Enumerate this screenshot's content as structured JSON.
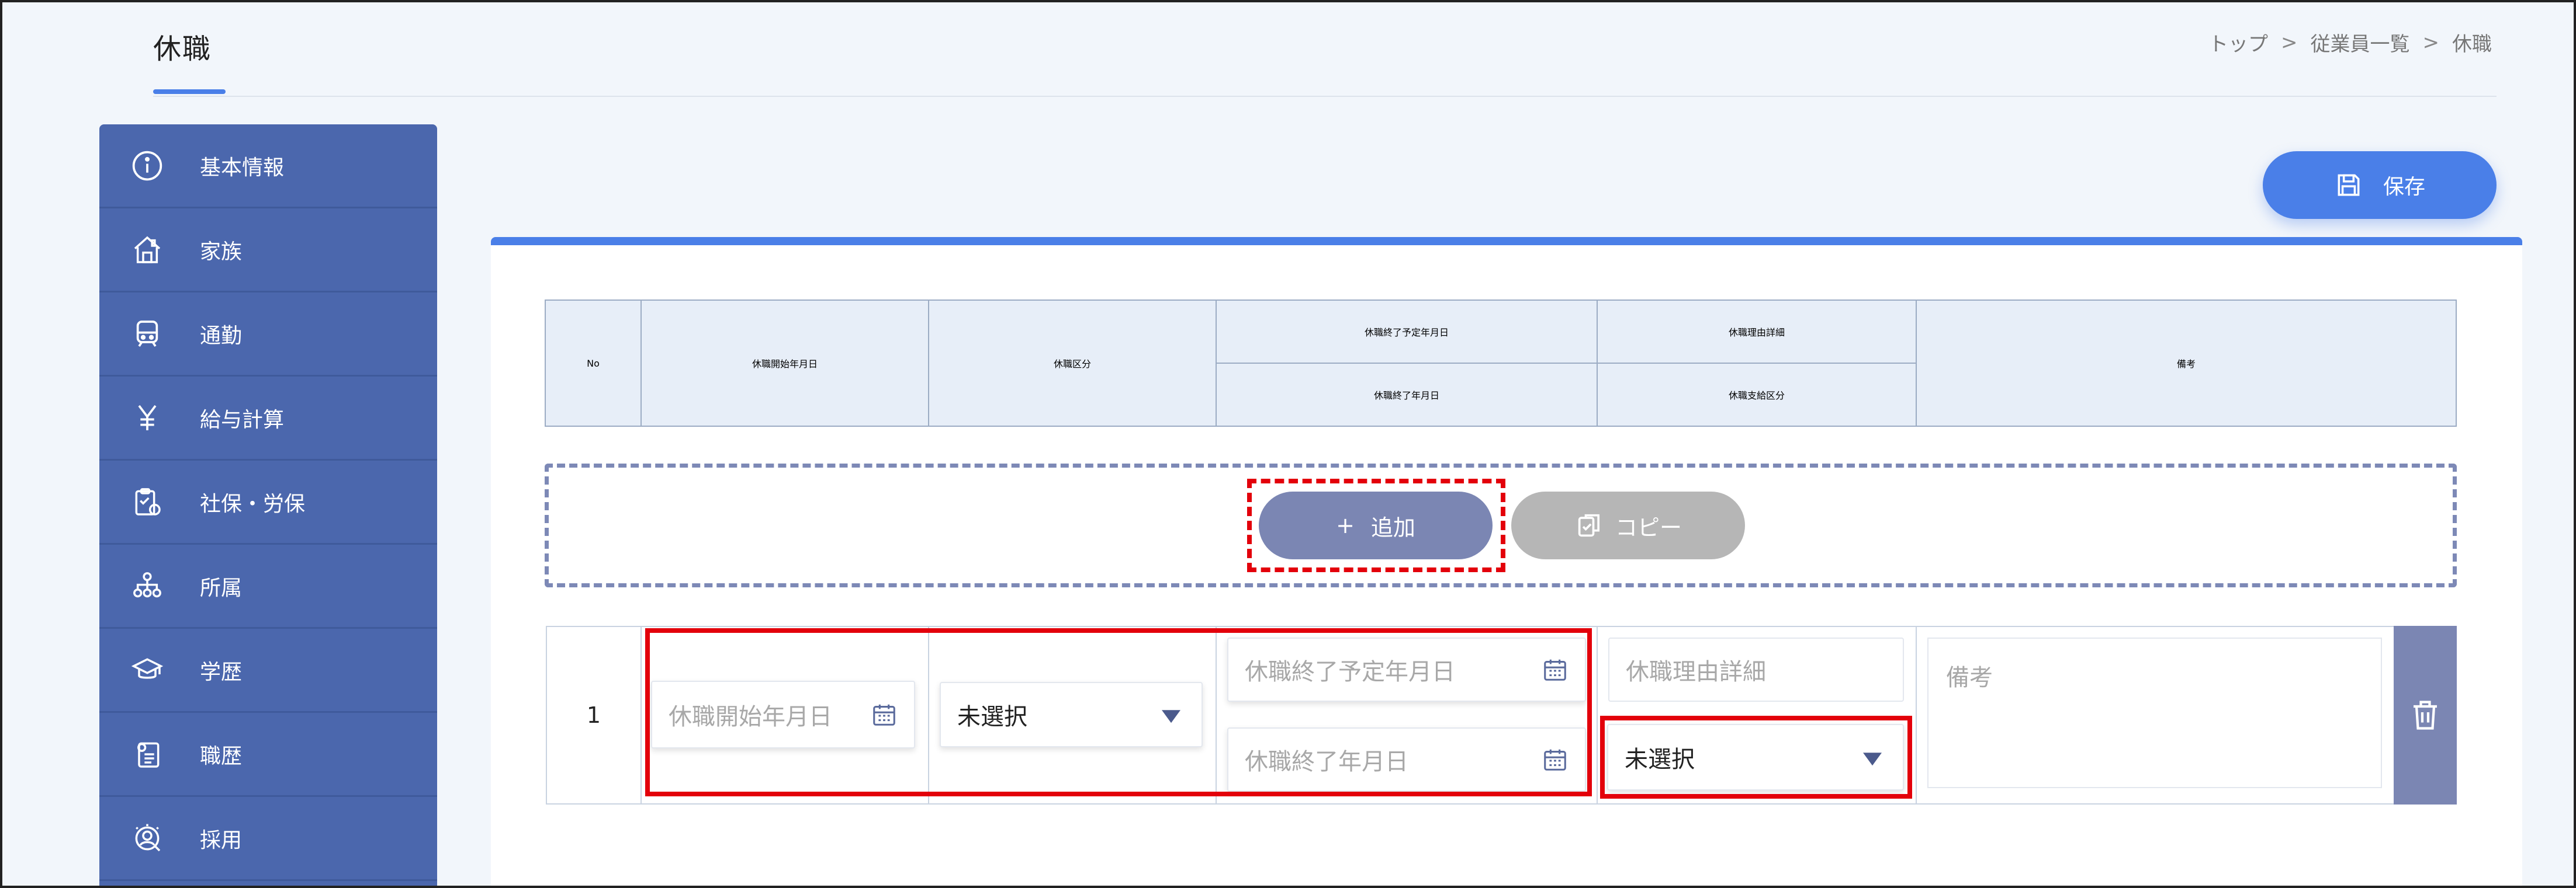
{
  "page": {
    "title": "休職"
  },
  "breadcrumb": {
    "items": [
      "トップ",
      "従業員一覧",
      "休職"
    ],
    "separator": ">"
  },
  "sidebar": {
    "items": [
      {
        "label": "基本情報",
        "icon": "info-icon"
      },
      {
        "label": "家族",
        "icon": "house-icon"
      },
      {
        "label": "通勤",
        "icon": "train-icon"
      },
      {
        "label": "給与計算",
        "icon": "yen-icon"
      },
      {
        "label": "社保・労保",
        "icon": "clipboard-icon"
      },
      {
        "label": "所属",
        "icon": "org-chart-icon"
      },
      {
        "label": "学歴",
        "icon": "graduation-cap-icon"
      },
      {
        "label": "職歴",
        "icon": "resume-icon"
      },
      {
        "label": "採用",
        "icon": "recruit-icon"
      }
    ]
  },
  "toolbar": {
    "save_label": "保存"
  },
  "table_header": {
    "no": "No",
    "start_date": "休職開始年月日",
    "category": "休職区分",
    "planned_end_date": "休職終了予定年月日",
    "end_date": "休職終了年月日",
    "reason_detail": "休職理由詳細",
    "pay_category": "休職支給区分",
    "remarks": "備考"
  },
  "actions": {
    "add_label": "追加",
    "add_prefix": "+",
    "copy_label": "コピー"
  },
  "row": {
    "no": "1",
    "start_date_placeholder": "休職開始年月日",
    "category_value": "未選択",
    "planned_end_date_placeholder": "休職終了予定年月日",
    "end_date_placeholder": "休職終了年月日",
    "reason_detail_placeholder": "休職理由詳細",
    "pay_category_value": "未選択",
    "remarks_placeholder": "備考"
  },
  "colors": {
    "accent": "#4a7fe8",
    "sidebar": "#4b67ad",
    "add_button": "#7b86b3",
    "copy_button": "#b6b6b6",
    "highlight": "#e3000b"
  }
}
